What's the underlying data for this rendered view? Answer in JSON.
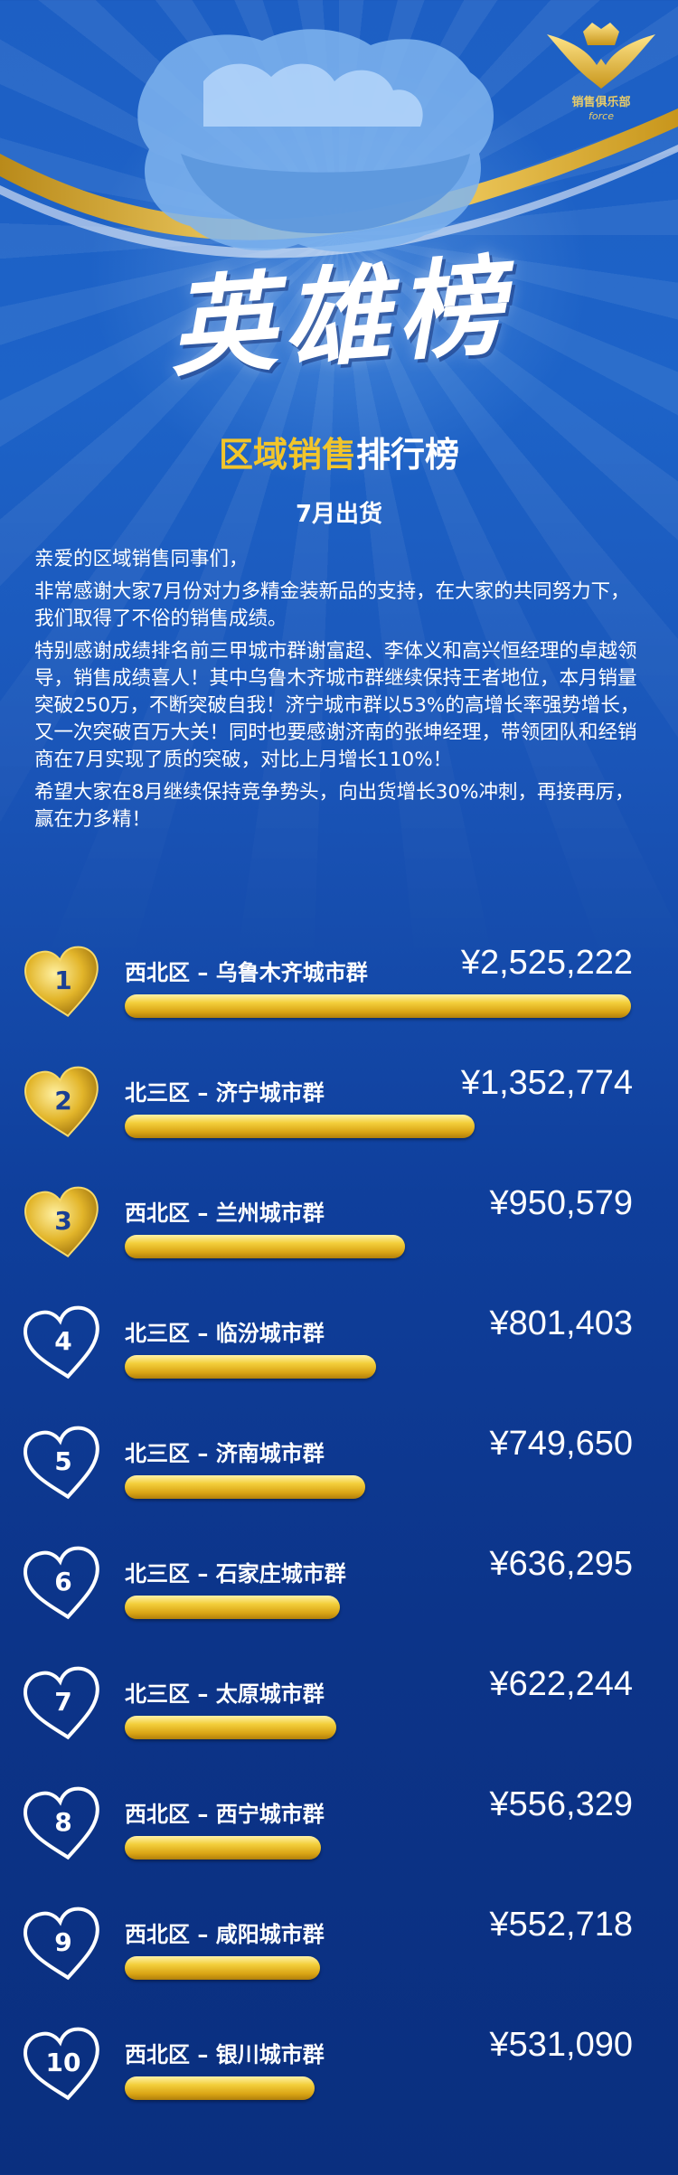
{
  "header": {
    "logo_name": "销售俱乐部",
    "logo_sub": "force",
    "hero_title": "英雄榜",
    "subtitle_highlight": "区域销售",
    "subtitle_rest": "排行榜",
    "month": "7月出货"
  },
  "intro": [
    "亲爱的区域销售同事们，",
    "非常感谢大家7月份对力多精金装新品的支持，在大家的共同努力下，我们取得了不俗的销售成绩。",
    "特别感谢成绩排名前三甲城市群谢富超、李体义和高兴恒经理的卓越领导，销售成绩喜人！其中乌鲁木齐城市群继续保持王者地位，本月销量突破250万，不断突破自我！济宁城市群以53%的高增长率强势增长，又一次突破百万大关！同时也要感谢济南的张坤经理，带领团队和经销商在7月实现了质的突破，对比上月增长110%！",
    "希望大家在8月继续保持竞争势头，向出货增长30%冲刺，再接再厉，赢在力多精！"
  ],
  "colors": {
    "gold": "#f3cf3c",
    "blue_bg": "#1d5fc4",
    "heart_outline": "#ffffff"
  },
  "rankings": [
    {
      "rank": "1",
      "region": "西北区 – 乌鲁木齐城市群",
      "amount": "¥2,525,222",
      "value": 2525222,
      "heart": "gold"
    },
    {
      "rank": "2",
      "region": "北三区 – 济宁城市群",
      "amount": "¥1,352,774",
      "value": 1352774,
      "heart": "gold"
    },
    {
      "rank": "3",
      "region": "西北区 – 兰州城市群",
      "amount": "¥950,579",
      "value": 950579,
      "heart": "gold"
    },
    {
      "rank": "4",
      "region": "北三区 – 临汾城市群",
      "amount": "¥801,403",
      "value": 801403,
      "heart": "blue"
    },
    {
      "rank": "5",
      "region": "北三区 – 济南城市群",
      "amount": "¥749,650",
      "value": 749650,
      "heart": "blue"
    },
    {
      "rank": "6",
      "region": "北三区 – 石家庄城市群",
      "amount": "¥636,295",
      "value": 636295,
      "heart": "blue"
    },
    {
      "rank": "7",
      "region": "北三区 – 太原城市群",
      "amount": "¥622,244",
      "value": 622244,
      "heart": "blue"
    },
    {
      "rank": "8",
      "region": "西北区 – 西宁城市群",
      "amount": "¥556,329",
      "value": 556329,
      "heart": "blue"
    },
    {
      "rank": "9",
      "region": "西北区 – 咸阳城市群",
      "amount": "¥552,718",
      "value": 552718,
      "heart": "blue"
    },
    {
      "rank": "10",
      "region": "西北区 – 银川城市群",
      "amount": "¥531,090",
      "value": 531090,
      "heart": "blue"
    }
  ]
}
